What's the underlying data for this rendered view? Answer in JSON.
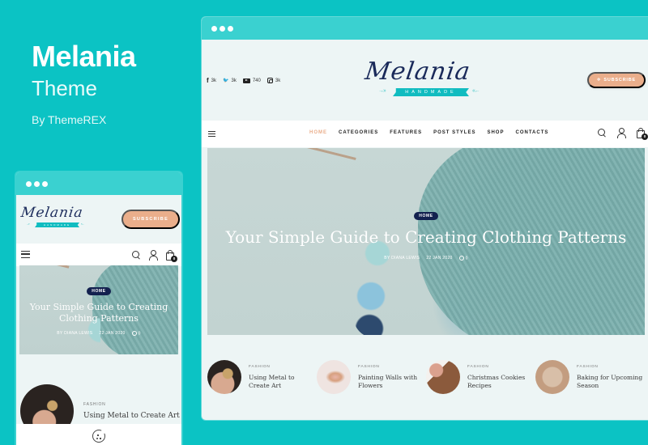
{
  "brand": {
    "title": "Melania",
    "subtitle": "Theme",
    "author": "By ThemeREX"
  },
  "colors": {
    "background": "#0bc3c4",
    "window_bar": "#3ad1d0",
    "accent_peach": "#eaae8b",
    "navy": "#13214f",
    "logo_teal": "#11bcc0"
  },
  "desktop": {
    "socials": [
      {
        "icon": "facebook-icon",
        "glyph": "f",
        "count": "3k"
      },
      {
        "icon": "twitter-icon",
        "glyph": "🐦",
        "count": "3k"
      },
      {
        "icon": "youtube-icon",
        "glyph": "",
        "count": "740"
      },
      {
        "icon": "instagram-icon",
        "glyph": "",
        "count": "3k"
      }
    ],
    "logo": {
      "script": "Melania",
      "tagline": "HANDMADE",
      "arrows_left": "→››",
      "arrows_right": "‹‹←"
    },
    "subscribe_label": "SUBSCRIBE",
    "subscribe_icon": "✈",
    "menu": [
      {
        "label": "HOME",
        "active": true
      },
      {
        "label": "CATEGORIES",
        "active": false
      },
      {
        "label": "FEATURES",
        "active": false
      },
      {
        "label": "POST STYLES",
        "active": false
      },
      {
        "label": "SHOP",
        "active": false
      },
      {
        "label": "CONTACTS",
        "active": false
      }
    ],
    "cart_count": "0",
    "hero": {
      "category": "HOME",
      "title": "Your Simple Guide to Creating Clothing Patterns",
      "author": "BY DIANA LEWIS",
      "date": "22 JAN 2020",
      "comments": "0"
    },
    "posts": [
      {
        "category": "FASHION",
        "title": "Using Metal to Create Art"
      },
      {
        "category": "FASHION",
        "title": "Painting Walls with Flowers"
      },
      {
        "category": "FASHION",
        "title": "Christmas Cookies Recipes"
      },
      {
        "category": "FASHION",
        "title": "Baking for Upcoming Season"
      }
    ]
  },
  "mobile": {
    "logo": {
      "script": "Melania",
      "tagline": "HANDMADE",
      "arrows_left": "→››",
      "arrows_right": "‹‹←"
    },
    "subscribe_label": "SUBSCRIBE",
    "cart_count": "0",
    "hero": {
      "category": "HOME",
      "title": "Your Simple Guide to Creating Clothing Patterns",
      "author": "BY DIANA LEWIS",
      "date": "22 JAN 2020",
      "comments": "0"
    },
    "post": {
      "category": "FASHION",
      "title": "Using Metal to Create Art"
    }
  }
}
